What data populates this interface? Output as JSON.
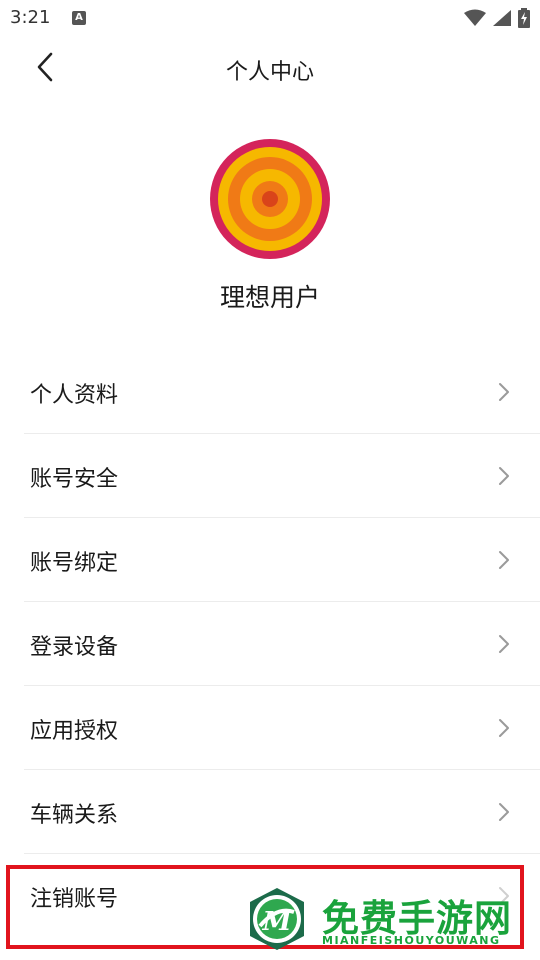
{
  "status": {
    "time": "3:21",
    "notification_glyph": "A"
  },
  "header": {
    "title": "个人中心"
  },
  "profile": {
    "username": "理想用户"
  },
  "menu": {
    "items": [
      {
        "label": "个人资料"
      },
      {
        "label": "账号安全"
      },
      {
        "label": "账号绑定"
      },
      {
        "label": "登录设备"
      },
      {
        "label": "应用授权"
      },
      {
        "label": "车辆关系"
      },
      {
        "label": "注销账号"
      }
    ]
  },
  "watermark": {
    "title": "免费手游网",
    "subtitle": "MIANFEISHOUYOUWANG",
    "logo_letter": "M"
  },
  "colors": {
    "highlight": "#e1141d",
    "watermark": "#1aa33c",
    "avatar_ring": "#d4245b",
    "avatar_yellow": "#f6b800",
    "avatar_orange": "#f07a16"
  }
}
